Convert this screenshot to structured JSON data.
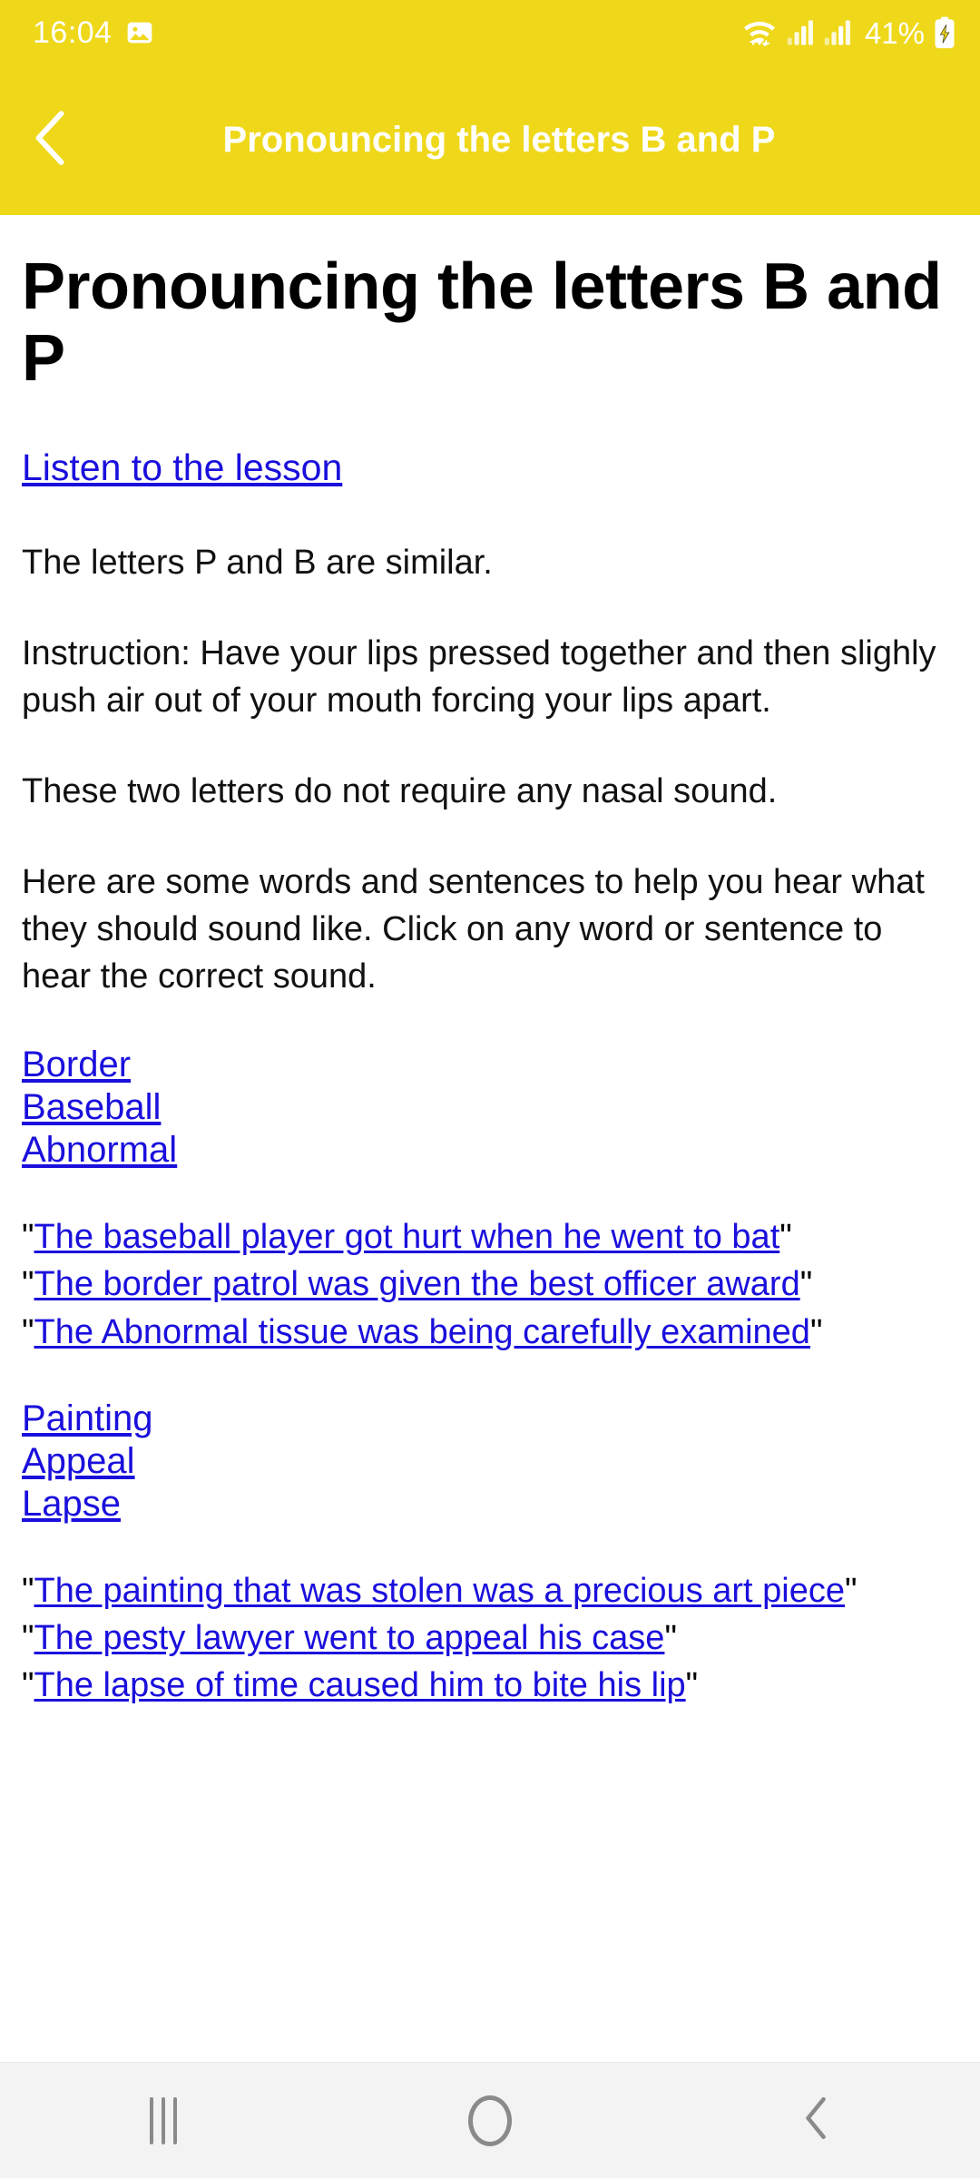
{
  "colors": {
    "brand": "#EFD81A",
    "link": "#1A0FDC",
    "navbar_bg": "#F3F3F3",
    "text": "#000000"
  },
  "statusbar": {
    "time": "16:04",
    "left_icons": [
      "image-icon"
    ],
    "right_icons": [
      "wifi-icon",
      "signal-icon",
      "signal-icon"
    ],
    "battery_percent": "41%",
    "battery_state": "charging"
  },
  "appbar": {
    "back_icon": "chevron-left-icon",
    "title": "Pronouncing the letters B and P"
  },
  "main": {
    "heading": "Pronouncing the letters B and P",
    "listen_link": "Listen to the lesson",
    "paragraphs": [
      "The letters P and B are similar.",
      "Instruction: Have your lips pressed together and then slighly push air out of your mouth forcing your lips apart.",
      "These two letters do not require any nasal sound.",
      "Here are some words and sentences to help you hear what they should sound like. Click on any word or sentence to hear the correct sound."
    ],
    "word_group_1": [
      "Border",
      "Baseball",
      "Abnormal"
    ],
    "sentence_group_1": [
      "The baseball player got hurt when he went to bat",
      "The border patrol was given the best officer award",
      "The Abnormal tissue was being carefully examined"
    ],
    "word_group_2": [
      "Painting",
      "Appeal",
      "Lapse"
    ],
    "sentence_group_2": [
      "The painting that was stolen was a precious art piece",
      "The pesty lawyer went to appeal his case",
      "The lapse of time caused him to bite his lip"
    ],
    "quote_char": "\""
  },
  "navbar": {
    "recents_label": "recents-icon",
    "home_label": "home-icon",
    "back_label": "back-icon"
  }
}
